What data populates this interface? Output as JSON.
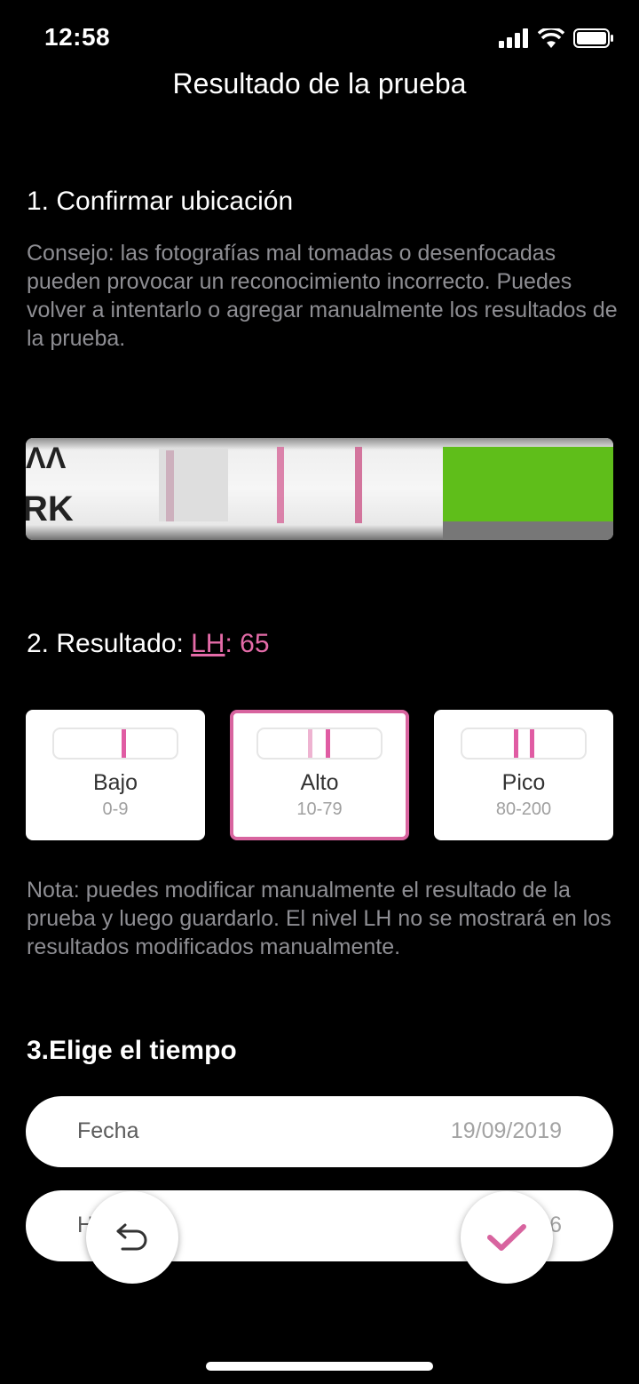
{
  "status": {
    "time": "12:58"
  },
  "nav": {
    "title": "Resultado de la prueba"
  },
  "step1": {
    "heading": "1. Confirmar ubicación",
    "tip": "Consejo: las fotografías mal tomadas o desenfocadas pueden provocar un reconocimiento incorrecto. Puedes volver a intentarlo o agregar manualmente los resultados de la prueba.",
    "strip_text_top": "ΛΛ",
    "strip_text_bottom": "RK"
  },
  "step2": {
    "heading_prefix": "2. Resultado: ",
    "lh_label": "LH",
    "lh_value": ": 65",
    "levels": [
      {
        "name": "Bajo",
        "range": "0-9",
        "selected": false,
        "lines": 1
      },
      {
        "name": "Alto",
        "range": "10-79",
        "selected": true,
        "lines": 2
      },
      {
        "name": "Pico",
        "range": "80-200",
        "selected": false,
        "lines": 2
      }
    ],
    "note": "Nota: puedes modificar manualmente el resultado de la prueba y luego guardarlo. El nivel LH no se mostrará en los resultados modificados manualmente."
  },
  "step3": {
    "heading": "3.Elige el tiempo",
    "date_label": "Fecha",
    "date_value": "19/09/2019",
    "hour_label_partial": "H",
    "hour_value_partial": "6"
  },
  "colors": {
    "accent": "#d8649f",
    "background": "#000000",
    "hint_text": "#8e8e93"
  },
  "icons": {
    "back": "undo-arrow-icon",
    "confirm": "checkmark-icon"
  }
}
